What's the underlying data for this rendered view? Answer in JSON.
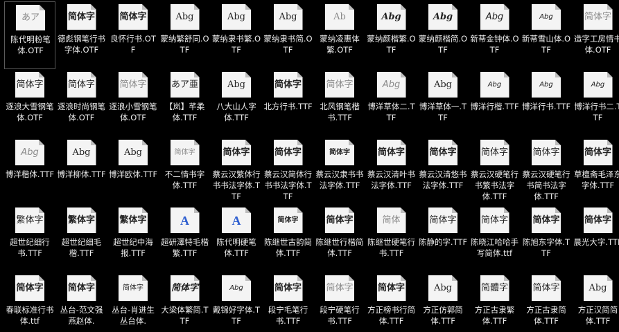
{
  "files": [
    {
      "name": "陈代明粉笔体.OTF",
      "sample": "あア",
      "style": "light"
    },
    {
      "name": "德彪钢笔行书字体.OTF",
      "sample": "简体字",
      "style": "bold"
    },
    {
      "name": "良怀行书.OTF",
      "sample": "简体字",
      "style": "bold"
    },
    {
      "name": "蒙纳繁舒同.OTF",
      "sample": "Abg",
      "style": ""
    },
    {
      "name": "蒙纳隶书繁.OTF",
      "sample": "Abg",
      "style": ""
    },
    {
      "name": "蒙纳隶书简.OTF",
      "sample": "Abg",
      "style": ""
    },
    {
      "name": "蒙纳凌惠体繁.OTF",
      "sample": "Ab",
      "style": "light"
    },
    {
      "name": "蒙纳颜楷繁.OTF",
      "sample": "Abg",
      "style": "bold italic"
    },
    {
      "name": "蒙纳颜楷简.OTF",
      "sample": "Abg",
      "style": "bold italic"
    },
    {
      "name": "新蒂金钟体.OTF",
      "sample": "Abg",
      "style": "script"
    },
    {
      "name": "新蒂雪山体.OTF",
      "sample": "Abg",
      "style": "script small"
    },
    {
      "name": "造字工房情书体.OTF",
      "sample": "简体字",
      "style": "light"
    },
    {
      "name": "逐浪大雪钢笔体.OTF",
      "sample": "简体字",
      "style": ""
    },
    {
      "name": "逐浪时尚钢笔体.OTF",
      "sample": "简体字",
      "style": ""
    },
    {
      "name": "逐浪小雪钢笔体.OTF",
      "sample": "简体字",
      "style": "light"
    },
    {
      "name": "【岚】芊柔体.TTF",
      "sample": "あア亜",
      "style": ""
    },
    {
      "name": "八大山人字体.TTF",
      "sample": "Abg",
      "style": ""
    },
    {
      "name": "北方行书.TTF",
      "sample": "简体字",
      "style": "bold"
    },
    {
      "name": "北风钢笔楷书.TTF",
      "sample": "简体字",
      "style": "light"
    },
    {
      "name": "博洋草体二.TTF",
      "sample": "Abg",
      "style": "script light"
    },
    {
      "name": "博洋草体一.TTF",
      "sample": "Abg",
      "style": ""
    },
    {
      "name": "博洋行楷.TTF",
      "sample": "Abg",
      "style": "script small"
    },
    {
      "name": "博洋行书.TTF",
      "sample": "Abg",
      "style": "script small"
    },
    {
      "name": "博洋行书二.TTF",
      "sample": "Abg",
      "style": "script small"
    },
    {
      "name": "博洋楷体.TTF",
      "sample": "Abg",
      "style": "script light"
    },
    {
      "name": "博洋柳体.TTF",
      "sample": "Abg",
      "style": ""
    },
    {
      "name": "博洋欧体.TTF",
      "sample": "Abg",
      "style": ""
    },
    {
      "name": "不二情书字体.TTF",
      "sample": "简体字",
      "style": "light small"
    },
    {
      "name": "蔡云汉繁体行书书法字体.TTF",
      "sample": "简体字",
      "style": "bold"
    },
    {
      "name": "蔡云汉简体行书书法字体.TTF",
      "sample": "简体字",
      "style": "bold"
    },
    {
      "name": "蔡云汉隶书书法字体.TTF",
      "sample": "简体字",
      "style": "bold small"
    },
    {
      "name": "蔡云汉清叶书法字体.TTF",
      "sample": "简体字",
      "style": "bold"
    },
    {
      "name": "蔡云汉清悠书法字体.TTF",
      "sample": "简体字",
      "style": "bold"
    },
    {
      "name": "蔡云汉硬笔行书繁书法字体.TTF",
      "sample": "简体字",
      "style": ""
    },
    {
      "name": "蔡云汉硬笔行书简书法字体.TTF",
      "sample": "简体字",
      "style": ""
    },
    {
      "name": "草檀斋毛泽东字体.TTF",
      "sample": "简体字",
      "style": "bold"
    },
    {
      "name": "超世纪细行书.TTF",
      "sample": "繁体字",
      "style": ""
    },
    {
      "name": "超世纪细毛楷.TTF",
      "sample": "繁体字",
      "style": "bold"
    },
    {
      "name": "超世纪中海报.TTF",
      "sample": "繁体字",
      "style": "bold"
    },
    {
      "name": "超研澤特毛楷繁.TTF",
      "sample": "A",
      "style": "blue"
    },
    {
      "name": "陈代明硬笔体.TTF",
      "sample": "A",
      "style": "blue"
    },
    {
      "name": "陈继世古韵简体.TTF",
      "sample": "简体字",
      "style": "bold small"
    },
    {
      "name": "陈继世行楷简体.TTF",
      "sample": "简体字",
      "style": "bold"
    },
    {
      "name": "陈继世硬笔行书.TTF",
      "sample": "简体",
      "style": "light"
    },
    {
      "name": "陈静的字.TTF",
      "sample": "简体字",
      "style": ""
    },
    {
      "name": "陈晓江哈哈手写简体.ttf",
      "sample": "简体字",
      "style": ""
    },
    {
      "name": "陈旭东字体.TTF",
      "sample": "简体字",
      "style": "bold"
    },
    {
      "name": "晨光大字.TTF",
      "sample": "简体字",
      "style": "bold"
    },
    {
      "name": "春联标准行书体.ttf",
      "sample": "简体字",
      "style": "bold"
    },
    {
      "name": "丛台-范文强燕赵体.",
      "sample": "简体字",
      "style": "bold"
    },
    {
      "name": "丛台-肖进生丛台体.",
      "sample": "简体字",
      "style": "small"
    },
    {
      "name": "大梁体繁简.TTF",
      "sample": "简体字",
      "style": "bold italic"
    },
    {
      "name": "戴锦好字体.TTF",
      "sample": "Abg",
      "style": "script small"
    },
    {
      "name": "段宁毛笔行书.TTF",
      "sample": "简体字",
      "style": "bold"
    },
    {
      "name": "段宁硬笔行书.TTF",
      "sample": "简体字",
      "style": "light"
    },
    {
      "name": "方正榜书行简体.TTF",
      "sample": "简体字",
      "style": "bold"
    },
    {
      "name": "方正仿郭简体.TTF",
      "sample": "Abg",
      "style": ""
    },
    {
      "name": "方正古隶繁体.TTF",
      "sample": "简體字",
      "style": ""
    },
    {
      "name": "方正古隶简体.TTF",
      "sample": "简体字",
      "style": ""
    },
    {
      "name": "方正汉简简体.TTF",
      "sample": "Abg",
      "style": ""
    }
  ]
}
